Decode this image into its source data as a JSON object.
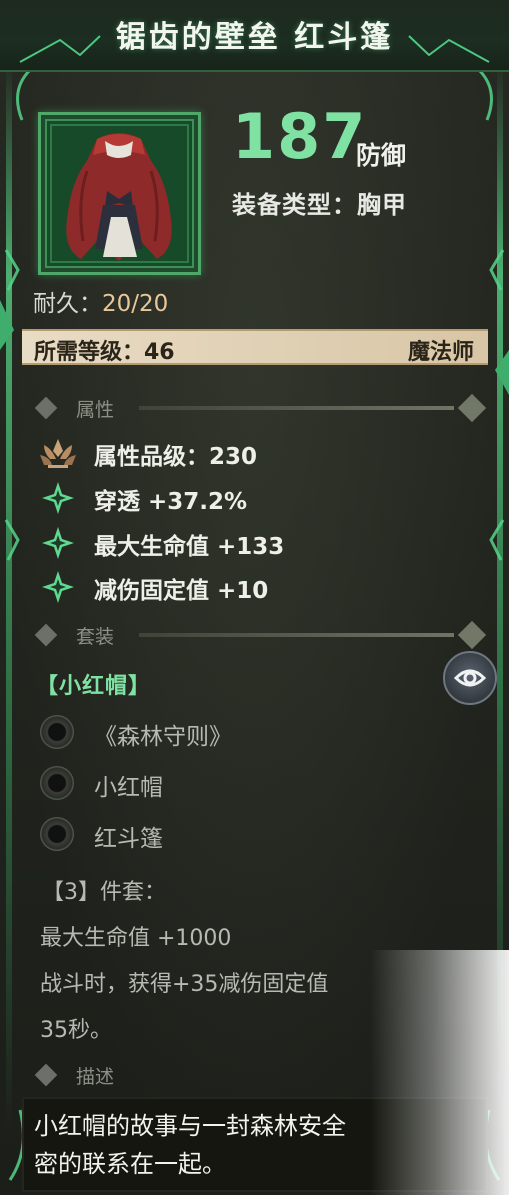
{
  "item": {
    "title": "锯齿的壁垒 红斗篷",
    "defense_value": "187",
    "defense_label": "防御",
    "equip_type": "装备类型：胸甲",
    "durability_label": "耐久：",
    "durability_value": "20/20",
    "required_level": "所需等级：46",
    "class_name": "魔法师"
  },
  "sections": {
    "attributes": "属性",
    "set": "套装",
    "description": "描述"
  },
  "attributes": [
    {
      "text": "属性品级：230",
      "icon": "lotus-icon"
    },
    {
      "text": "穿透 +37.2%",
      "icon": "sparkle-icon"
    },
    {
      "text": "最大生命值 +133",
      "icon": "sparkle-icon"
    },
    {
      "text": "减伤固定值 +10",
      "icon": "sparkle-icon"
    }
  ],
  "set": {
    "name": "【小红帽】",
    "pieces": [
      "《森林守则》",
      "小红帽",
      "红斗篷"
    ],
    "bonus_header": "【3】件套：",
    "bonus_line1": "最大生命值 +1000",
    "bonus_line2": "战斗时，获得+35减伤固定值",
    "bonus_line3": "35秒。"
  },
  "description": {
    "line1": "小红帽的故事与一封森林安全",
    "line2": "密的联系在一起。"
  },
  "colors": {
    "accent_green": "#7fe2a3",
    "durability_value": "#e8c79a",
    "req_bar": "#e9dcc5"
  }
}
